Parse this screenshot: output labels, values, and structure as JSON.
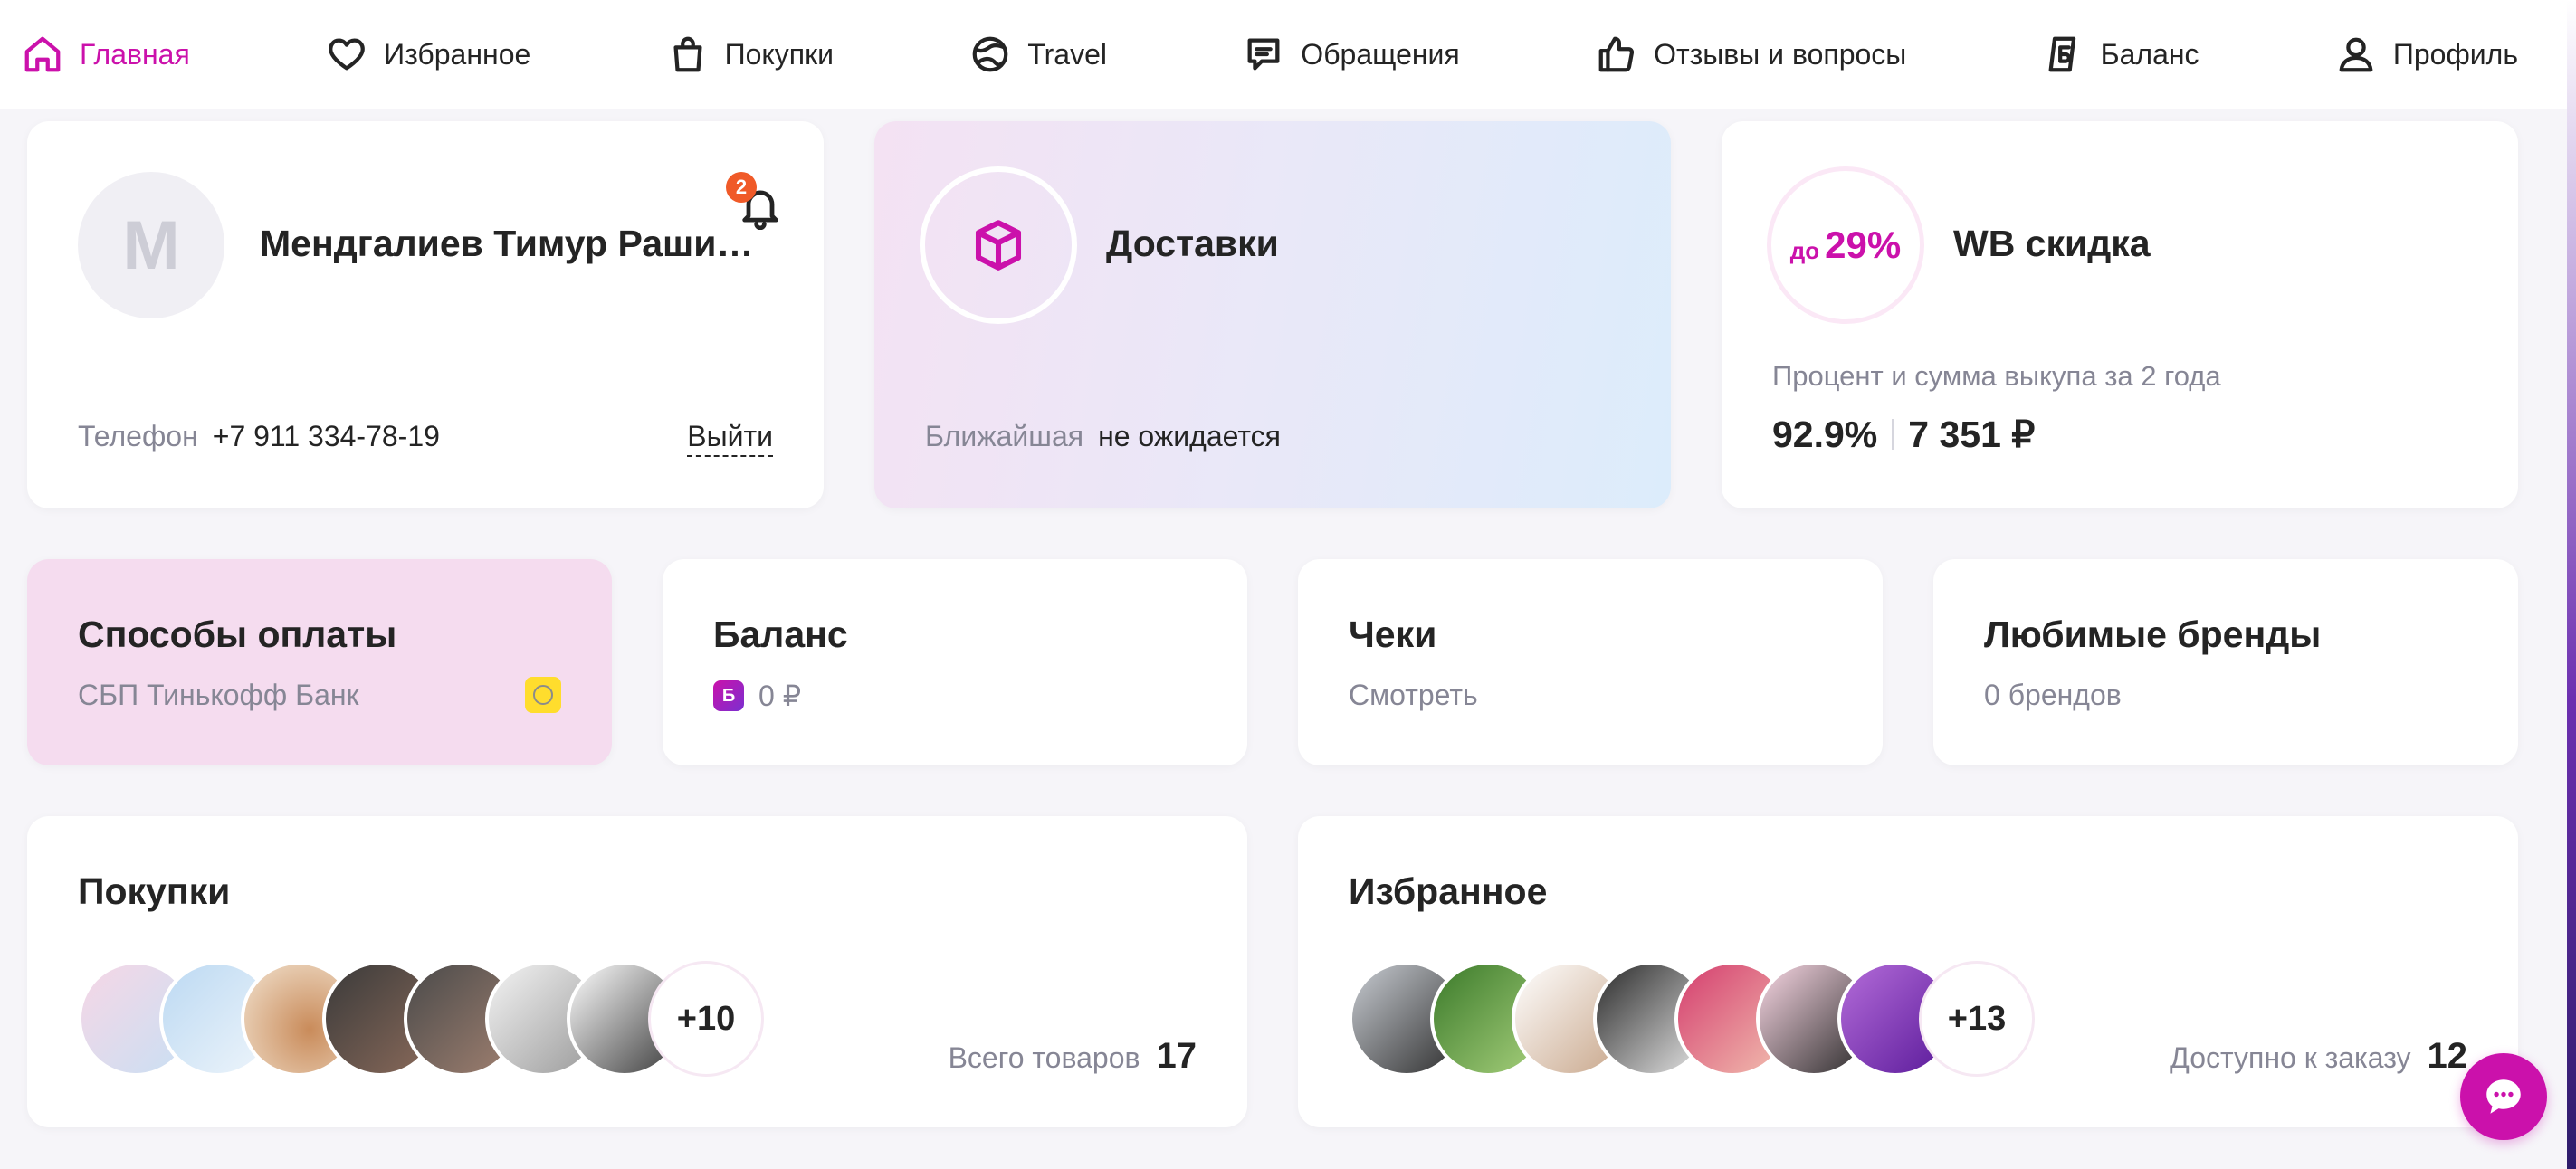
{
  "nav": {
    "items": [
      {
        "label": "Главная",
        "icon": "home-icon",
        "active": true
      },
      {
        "label": "Избранное",
        "icon": "heart-icon"
      },
      {
        "label": "Покупки",
        "icon": "bag-icon"
      },
      {
        "label": "Travel",
        "icon": "globe-icon"
      },
      {
        "label": "Обращения",
        "icon": "message-icon"
      },
      {
        "label": "Отзывы и вопросы",
        "icon": "thumbs-up-icon"
      },
      {
        "label": "Баланс",
        "icon": "balance-icon"
      },
      {
        "label": "Профиль",
        "icon": "user-icon"
      }
    ]
  },
  "profile": {
    "avatar_letter": "M",
    "name": "Мендгалиев Тимур Рашид...",
    "notifications": "2",
    "phone_label": "Телефон",
    "phone": "+7 911 334-78-19",
    "logout": "Выйти"
  },
  "delivery": {
    "title": "Доставки",
    "nearest_label": "Ближайшая",
    "nearest_value": "не ожидается"
  },
  "wb_discount": {
    "prefix": "до",
    "percent": "29%",
    "title": "WB скидка",
    "subtitle": "Процент и сумма выкупа за 2 года",
    "buyout_percent": "92.9%",
    "buyout_sum": "7 351 ₽"
  },
  "payment": {
    "title": "Способы оплаты",
    "subtitle": "СБП Тинькофф Банк"
  },
  "balance": {
    "title": "Баланс",
    "icon_letter": "Б",
    "value": "0 ₽"
  },
  "receipts": {
    "title": "Чеки",
    "subtitle": "Смотреть"
  },
  "brands": {
    "title": "Любимые бренды",
    "subtitle": "0 брендов"
  },
  "purchases": {
    "title": "Покупки",
    "more": "+10",
    "total_label": "Всего товаров",
    "total_value": "17"
  },
  "favorites": {
    "title": "Избранное",
    "more": "+13",
    "total_label": "Доступно к заказу",
    "total_value": "12"
  },
  "colors": {
    "accent": "#cb11ab",
    "payment_bg": "#f5dcef",
    "badge": "#f05a28"
  }
}
